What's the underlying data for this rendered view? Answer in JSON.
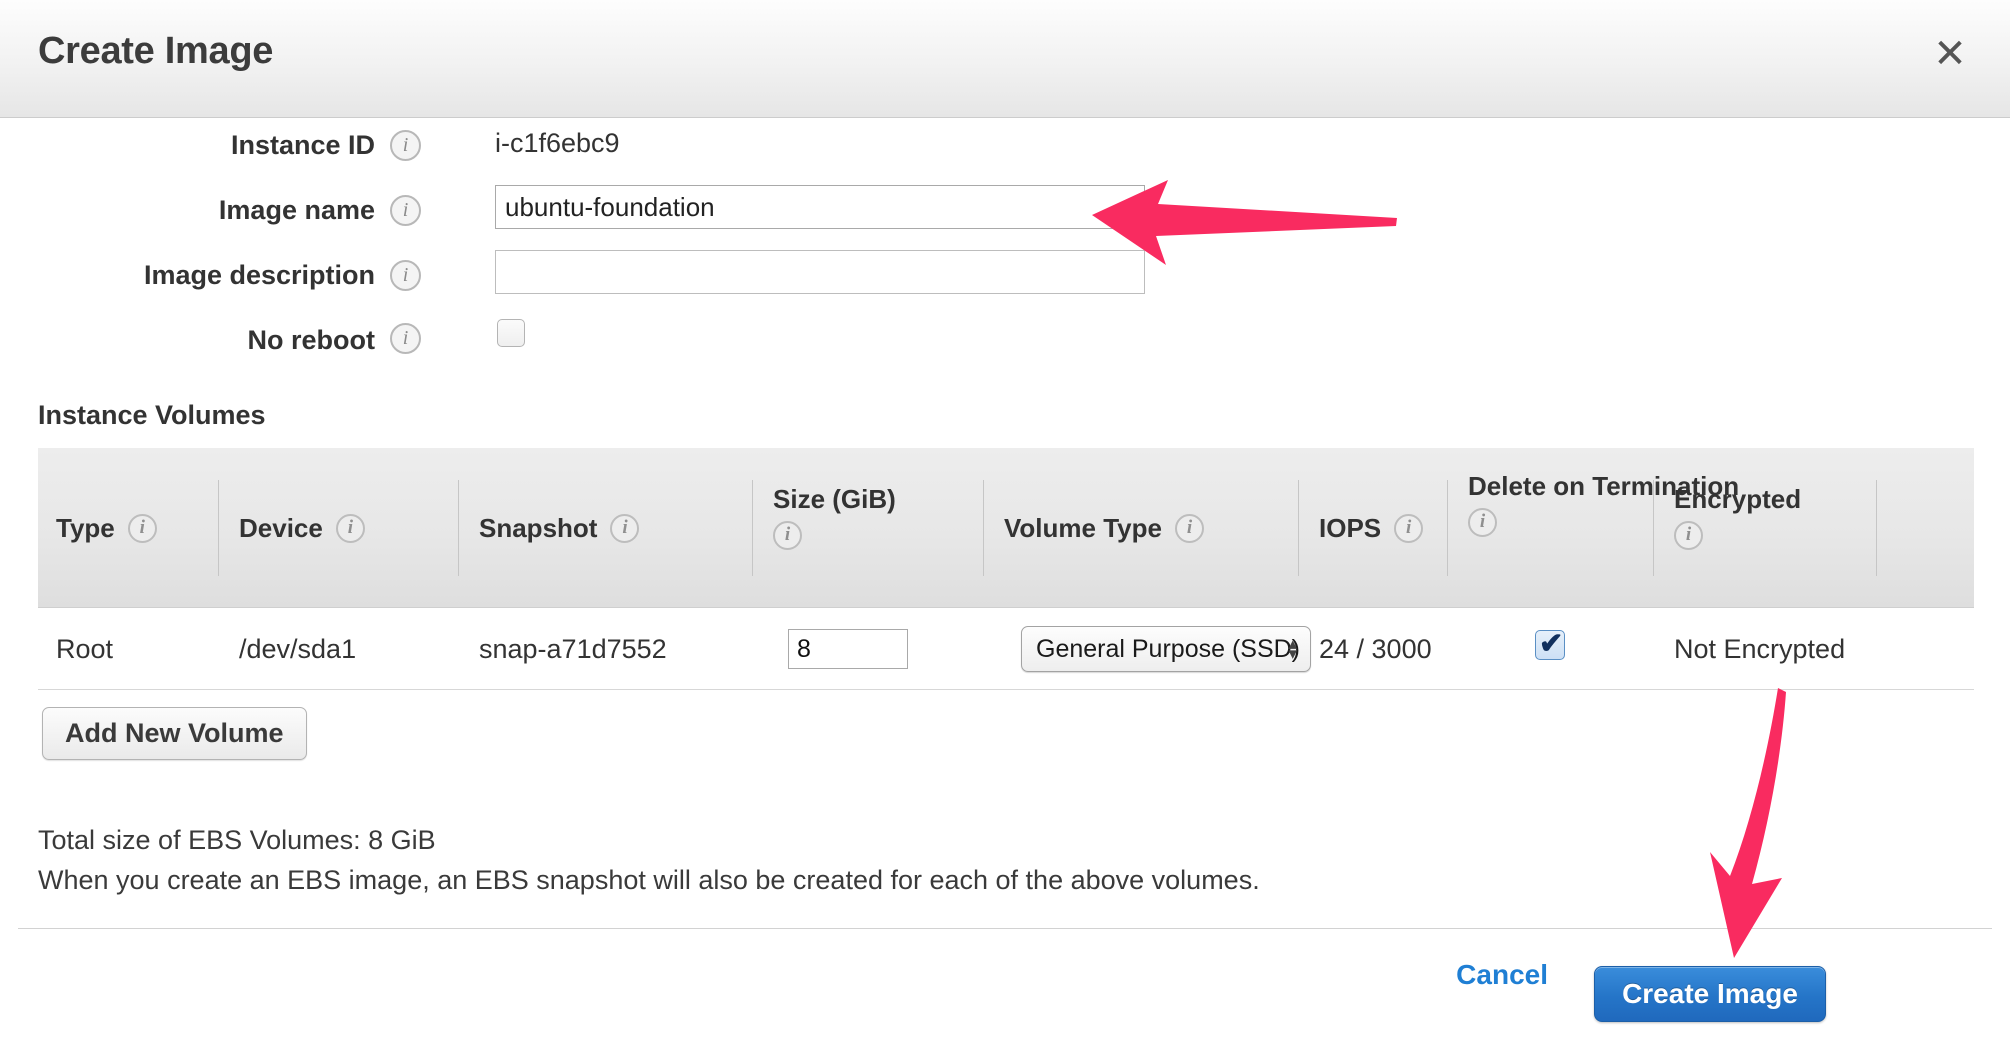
{
  "dialog": {
    "title": "Create Image",
    "close_icon": "close-icon"
  },
  "form": {
    "rows": [
      {
        "label": "Instance ID",
        "info": "info-icon",
        "type": "text",
        "value": "i-c1f6ebc9"
      },
      {
        "label": "Image name",
        "info": "info-icon",
        "type": "input",
        "value": "ubuntu-foundation",
        "placeholder": ""
      },
      {
        "label": "Image description",
        "info": "info-icon",
        "type": "input",
        "value": "",
        "placeholder": ""
      },
      {
        "label": "No reboot",
        "info": "info-icon",
        "type": "checkbox",
        "checked": false
      }
    ]
  },
  "volumes": {
    "section_title": "Instance Volumes",
    "columns": [
      {
        "label": "Type",
        "info": "info-icon"
      },
      {
        "label": "Device",
        "info": "info-icon"
      },
      {
        "label": "Snapshot",
        "info": "info-icon"
      },
      {
        "label": "Size (GiB)",
        "info": "info-icon"
      },
      {
        "label": "Volume Type",
        "info": "info-icon"
      },
      {
        "label": "IOPS",
        "info": "info-icon"
      },
      {
        "label": "Delete on Termination",
        "info": "info-icon"
      },
      {
        "label": "Encrypted",
        "info": "info-icon"
      }
    ],
    "rows": [
      {
        "type": "Root",
        "device": "/dev/sda1",
        "snapshot": "snap-a71d7552",
        "size": "8",
        "volume_type": "General Purpose (SSD)",
        "iops": "24 / 3000",
        "delete_on_termination": true,
        "encrypted": "Not Encrypted"
      }
    ],
    "add_volume_label": "Add New Volume"
  },
  "notes": {
    "total_size": "Total size of EBS Volumes: 8 GiB",
    "snapshot_note": "When you create an EBS image, an EBS snapshot will also be created for each of the above volumes."
  },
  "actions": {
    "cancel_label": "Cancel",
    "create_label": "Create Image"
  },
  "annotations": {
    "arrow_color": "#F92B60",
    "arrow_image_name": "arrow-pointing-left-at-image-name-field",
    "arrow_create_image": "arrow-pointing-down-at-create-image-button"
  },
  "colors": {
    "accent_blue": "#2575C8",
    "link_blue": "#1F7FD4",
    "annotation_pink": "#F92B60",
    "header_gray": "#E6E6E6"
  }
}
